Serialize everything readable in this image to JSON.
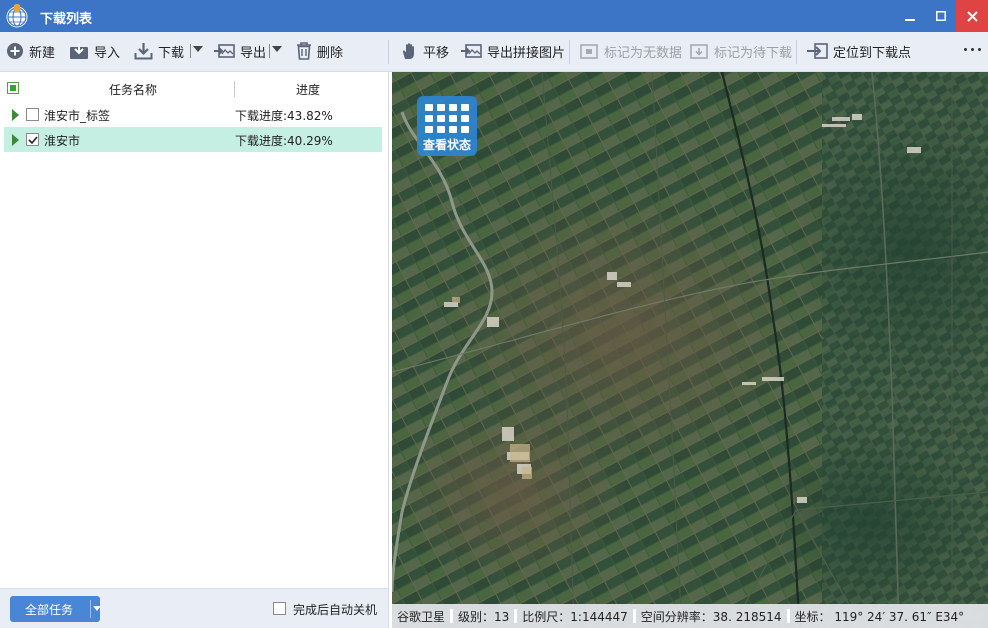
{
  "window": {
    "title": "下载列表",
    "controls": {
      "minimize": "minimize",
      "maximize": "maximize",
      "close": "close"
    }
  },
  "toolbar": {
    "new_label": "新建",
    "import_label": "导入",
    "download_label": "下载",
    "export_label": "导出",
    "delete_label": "删除",
    "pan_label": "平移",
    "export_mosaic_label": "导出拼接图片",
    "mark_nodata_label": "标记为无数据",
    "mark_pending_label": "标记为待下载",
    "locate_label": "定位到下载点"
  },
  "task_list": {
    "columns": {
      "name": "任务名称",
      "progress": "进度"
    },
    "rows": [
      {
        "name": "淮安市_标签",
        "progress": "下载进度:43.82%",
        "checked": false,
        "selected": false
      },
      {
        "name": "淮安市",
        "progress": "下载进度:40.29%",
        "checked": true,
        "selected": true
      }
    ]
  },
  "bottom": {
    "all_tasks_label": "全部任务",
    "auto_shutdown_label": "完成后自动关机",
    "auto_shutdown_checked": false
  },
  "map": {
    "view_status_label": "查看状态",
    "statusbar": {
      "source": "谷歌卫星",
      "level": "级别：13",
      "scale": "比例尺：1:144447",
      "resolution": "空间分辨率：38. 218514",
      "coords": "坐标： 119° 24′ 37. 61″ E34°"
    }
  },
  "colors": {
    "titlebar": "#3c74c6",
    "close": "#e04343",
    "selected_row": "#c5efe2",
    "accent_button": "#4a86d8"
  }
}
